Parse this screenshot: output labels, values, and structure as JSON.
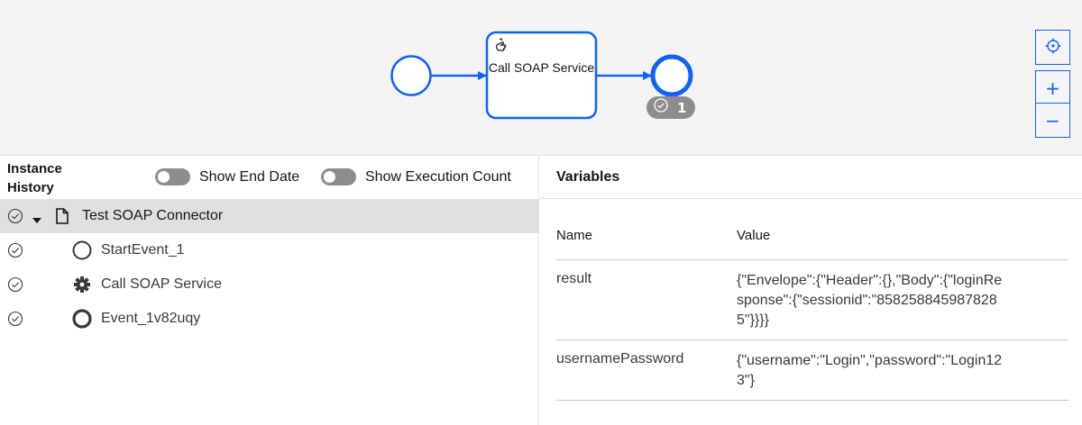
{
  "diagram": {
    "task": {
      "label": "Call SOAP Service",
      "icon": "hand-task-icon"
    },
    "end_event": {
      "badge_count": "1",
      "badge_icon": "check-circle-icon"
    },
    "controls": [
      {
        "name": "reset-view",
        "icon": "crosshair-icon"
      },
      {
        "name": "zoom-in",
        "label": "+"
      },
      {
        "name": "zoom-out",
        "label": "−"
      }
    ],
    "colors": {
      "accent": "#0f62fe",
      "canvas": "#f4f4f4",
      "badge": "#8d8d8d"
    }
  },
  "history": {
    "title": "Instance History",
    "toggles": [
      {
        "label": "Show End Date",
        "on": false
      },
      {
        "label": "Show Execution Count",
        "on": false
      }
    ],
    "root": {
      "label": "Test SOAP Connector",
      "status_icon": "check-circle-icon",
      "icon": "document-icon"
    },
    "items": [
      {
        "label": "StartEvent_1",
        "status_icon": "check-circle-icon",
        "icon": "start-event-icon"
      },
      {
        "label": "Call SOAP Service",
        "status_icon": "check-circle-icon",
        "icon": "gear-icon"
      },
      {
        "label": "Event_1v82uqy",
        "status_icon": "check-circle-icon",
        "icon": "end-event-icon"
      }
    ]
  },
  "variables": {
    "title": "Variables",
    "columns": {
      "name": "Name",
      "value": "Value"
    },
    "rows": [
      {
        "name": "result",
        "value": "{\"Envelope\":{\"Header\":{},\"Body\":{\"loginResponse\":{\"sessionid\":\"8582588459878285\"}}}}"
      },
      {
        "name": "usernamePassword",
        "value": "{\"username\":\"Login\",\"password\":\"Login123\"}"
      }
    ]
  }
}
